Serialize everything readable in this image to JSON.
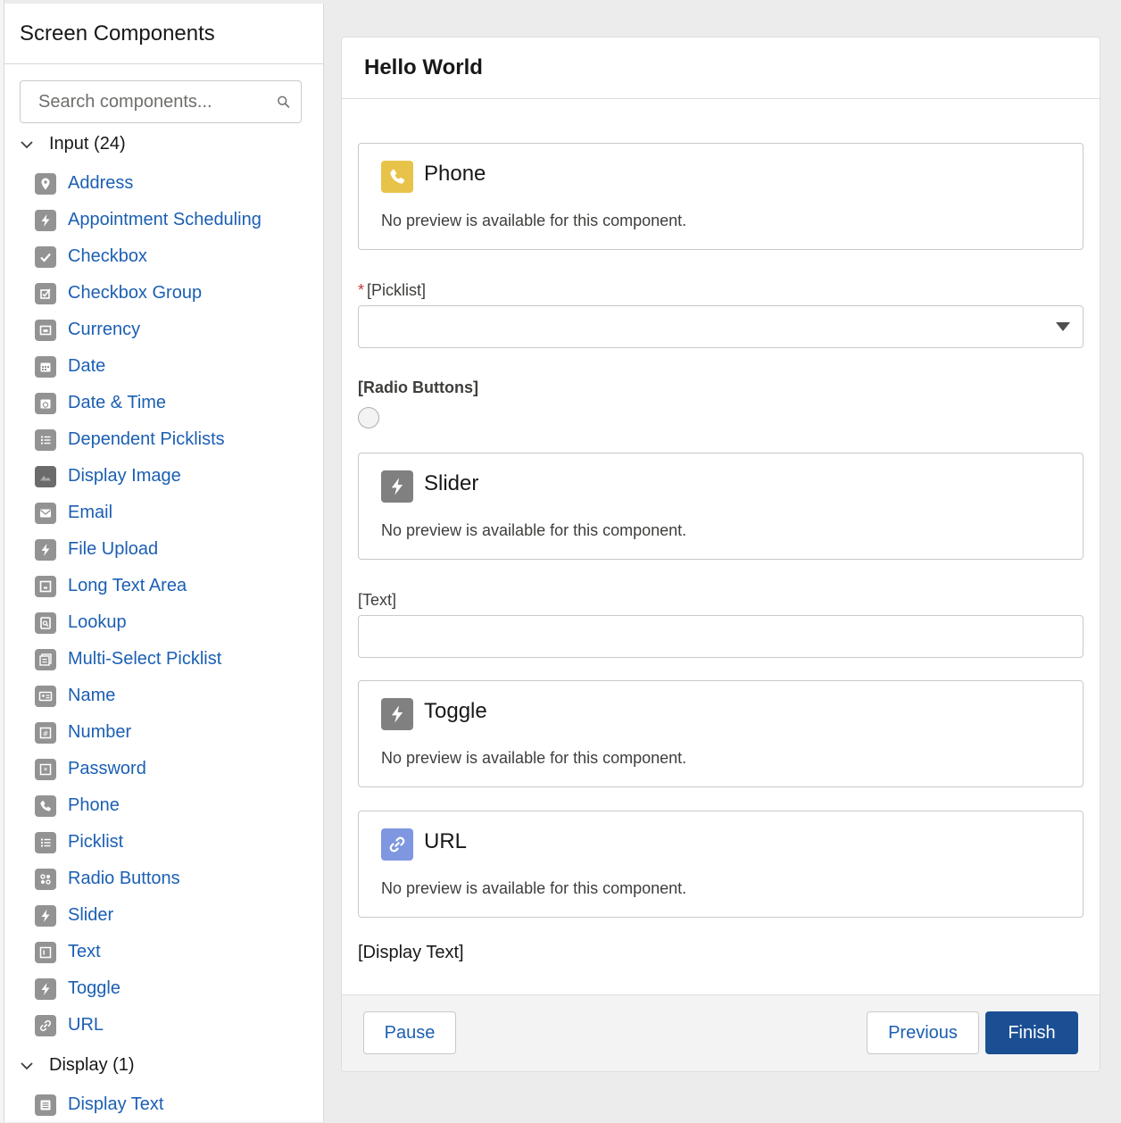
{
  "sidebar": {
    "title": "Screen Components",
    "search": {
      "placeholder": "Search components..."
    },
    "sections": [
      {
        "label": "Input (24)"
      },
      {
        "label": "Display (1)"
      }
    ],
    "input_items": [
      {
        "label": "Address",
        "icon": "location-pin-icon"
      },
      {
        "label": "Appointment Scheduling",
        "icon": "lightning-bolt-icon"
      },
      {
        "label": "Checkbox",
        "icon": "checkmark-icon"
      },
      {
        "label": "Checkbox Group",
        "icon": "checkbox-group-icon"
      },
      {
        "label": "Currency",
        "icon": "currency-icon"
      },
      {
        "label": "Date",
        "icon": "calendar-icon"
      },
      {
        "label": "Date & Time",
        "icon": "calendar-clock-icon"
      },
      {
        "label": "Dependent Picklists",
        "icon": "list-icon"
      },
      {
        "label": "Display Image",
        "icon": "image-icon"
      },
      {
        "label": "Email",
        "icon": "envelope-icon"
      },
      {
        "label": "File Upload",
        "icon": "lightning-bolt-icon"
      },
      {
        "label": "Long Text Area",
        "icon": "text-area-icon"
      },
      {
        "label": "Lookup",
        "icon": "lookup-icon"
      },
      {
        "label": "Multi-Select Picklist",
        "icon": "multi-select-icon"
      },
      {
        "label": "Name",
        "icon": "name-card-icon"
      },
      {
        "label": "Number",
        "icon": "number-icon"
      },
      {
        "label": "Password",
        "icon": "password-icon"
      },
      {
        "label": "Phone",
        "icon": "phone-icon"
      },
      {
        "label": "Picklist",
        "icon": "list-icon"
      },
      {
        "label": "Radio Buttons",
        "icon": "radio-buttons-icon"
      },
      {
        "label": "Slider",
        "icon": "lightning-bolt-icon"
      },
      {
        "label": "Text",
        "icon": "text-field-icon"
      },
      {
        "label": "Toggle",
        "icon": "lightning-bolt-icon"
      },
      {
        "label": "URL",
        "icon": "link-icon"
      }
    ],
    "display_items": [
      {
        "label": "Display Text",
        "icon": "display-text-icon"
      }
    ]
  },
  "canvas": {
    "title": "Hello World",
    "cards": [
      {
        "title": "Phone",
        "desc": "No preview is available for this component.",
        "icon": "phone-icon",
        "color": "#e8c34a"
      },
      {
        "title": "Slider",
        "desc": "No preview is available for this component.",
        "icon": "lightning-bolt-icon",
        "color": "#808080"
      },
      {
        "title": "Toggle",
        "desc": "No preview is available for this component.",
        "icon": "lightning-bolt-icon",
        "color": "#808080"
      },
      {
        "title": "URL",
        "desc": "No preview is available for this component.",
        "icon": "link-icon",
        "color": "#7f97e0"
      }
    ],
    "picklist_label": "[Picklist]",
    "required_mark": "*",
    "radio_label": "[Radio Buttons]",
    "text_label": "[Text]",
    "display_text": "[Display Text]"
  },
  "footer": {
    "pause": "Pause",
    "previous": "Previous",
    "finish": "Finish"
  },
  "colors": {
    "link": "#1b5fb3",
    "brand": "#1b4f94",
    "icon_gray": "#939393",
    "required": "#c23934"
  }
}
